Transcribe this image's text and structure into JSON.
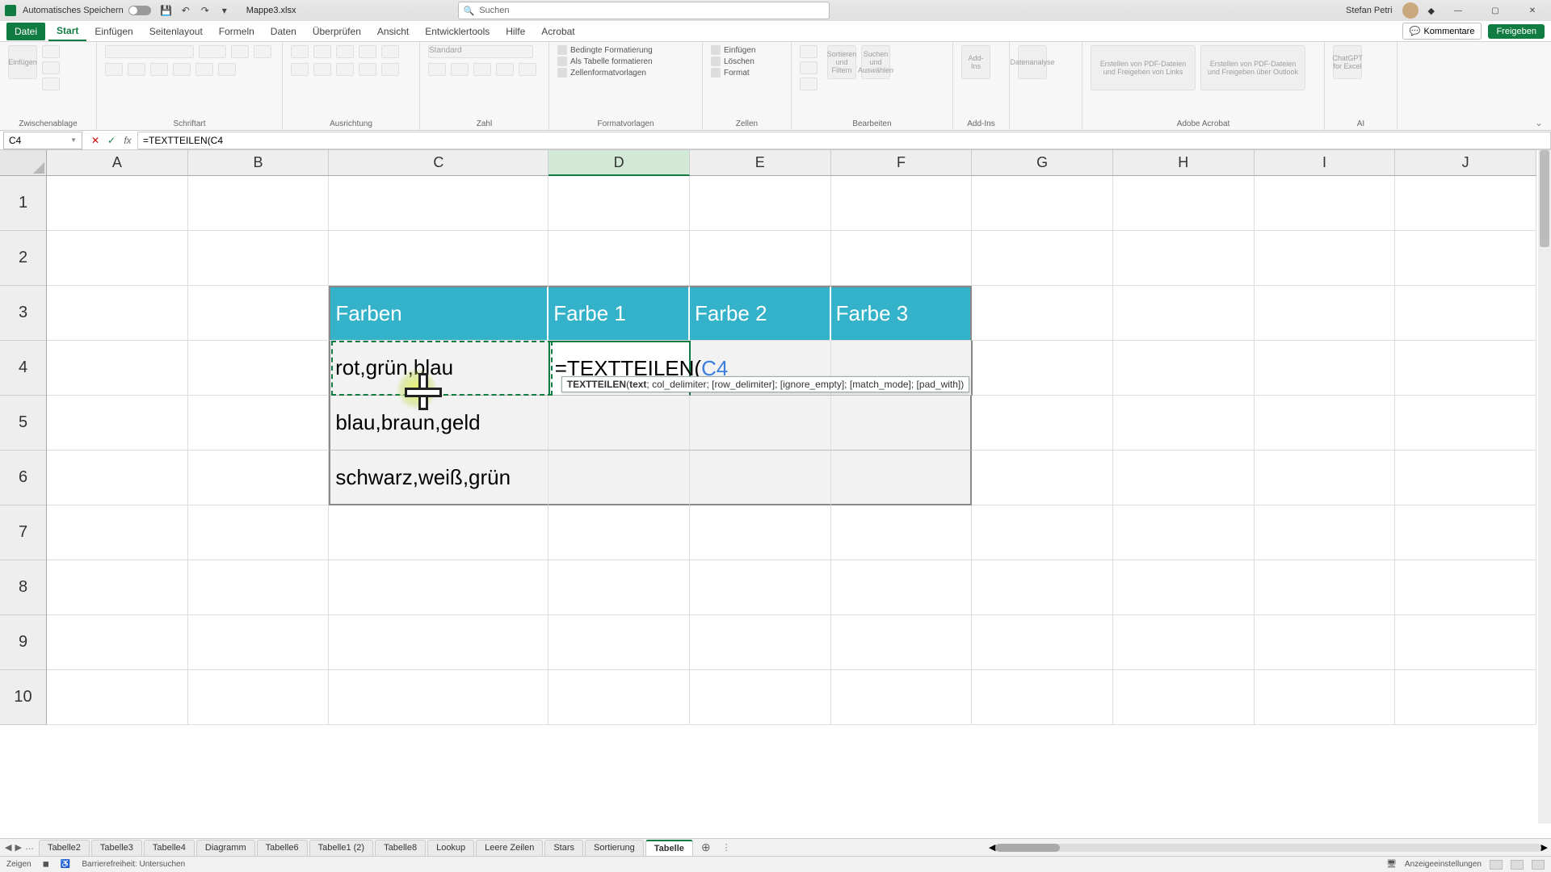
{
  "titlebar": {
    "autosave_label": "Automatisches Speichern",
    "filename": "Mappe3.xlsx",
    "search_placeholder": "Suchen",
    "user": "Stefan Petri"
  },
  "tabs": {
    "file": "Datei",
    "items": [
      "Start",
      "Einfügen",
      "Seitenlayout",
      "Formeln",
      "Daten",
      "Überprüfen",
      "Ansicht",
      "Entwicklertools",
      "Hilfe",
      "Acrobat"
    ],
    "active": "Start",
    "comments": "Kommentare",
    "share": "Freigeben"
  },
  "ribbon": {
    "clipboard": {
      "paste": "Einfügen",
      "label": "Zwischenablage"
    },
    "font": {
      "label": "Schriftart"
    },
    "align": {
      "label": "Ausrichtung"
    },
    "number": {
      "label": "Zahl",
      "format": "Standard"
    },
    "styles": {
      "cond": "Bedingte Formatierung",
      "tbl": "Als Tabelle formatieren",
      "cell": "Zellenformatvorlagen",
      "label": "Formatvorlagen"
    },
    "cells": {
      "ins": "Einfügen",
      "del": "Löschen",
      "fmt": "Format",
      "label": "Zellen"
    },
    "editing": {
      "sort": "Sortieren und Filtern",
      "find": "Suchen und Auswählen",
      "label": "Bearbeiten"
    },
    "addins": {
      "addin": "Add-Ins",
      "label": "Add-Ins"
    },
    "data": {
      "analysis": "Datenanalyse"
    },
    "acrobat": {
      "a": "Erstellen von PDF-Dateien und Freigeben von Links",
      "b": "Erstellen von PDF-Dateien und Freigeben über Outlook",
      "label": "Adobe Acrobat"
    },
    "ai": {
      "gpt": "ChatGPT for Excel",
      "label": "AI"
    }
  },
  "formula_bar": {
    "namebox": "C4",
    "value": "=TEXTTEILEN(C4",
    "tooltip": "TEXTTEILEN(text; col_delimiter; [row_delimiter]; [ignore_empty]; [match_mode]; [pad_with])"
  },
  "columns": [
    "A",
    "B",
    "C",
    "D",
    "E",
    "F",
    "G",
    "H",
    "I",
    "J"
  ],
  "rows": [
    "1",
    "2",
    "3",
    "4",
    "5",
    "6",
    "7",
    "8",
    "9",
    "10"
  ],
  "table": {
    "headers": [
      "Farben",
      "Farbe 1",
      "Farbe 2",
      "Farbe 3"
    ],
    "rows": [
      "rot,grün,blau",
      "blau,braun,geld",
      "schwarz,weiß,grün"
    ]
  },
  "edit_cell": {
    "plain": "=TEXTTEILEN(",
    "ref": "C4"
  },
  "sheet_tabs": [
    "Tabelle2",
    "Tabelle3",
    "Tabelle4",
    "Diagramm",
    "Tabelle6",
    "Tabelle1 (2)",
    "Tabelle8",
    "Lookup",
    "Leere Zeilen",
    "Stars",
    "Sortierung",
    "Tabelle"
  ],
  "sheet_active": "Tabelle",
  "status": {
    "mode": "Zeigen",
    "acc": "Barrierefreiheit: Untersuchen",
    "display": "Anzeigeeinstellungen"
  }
}
